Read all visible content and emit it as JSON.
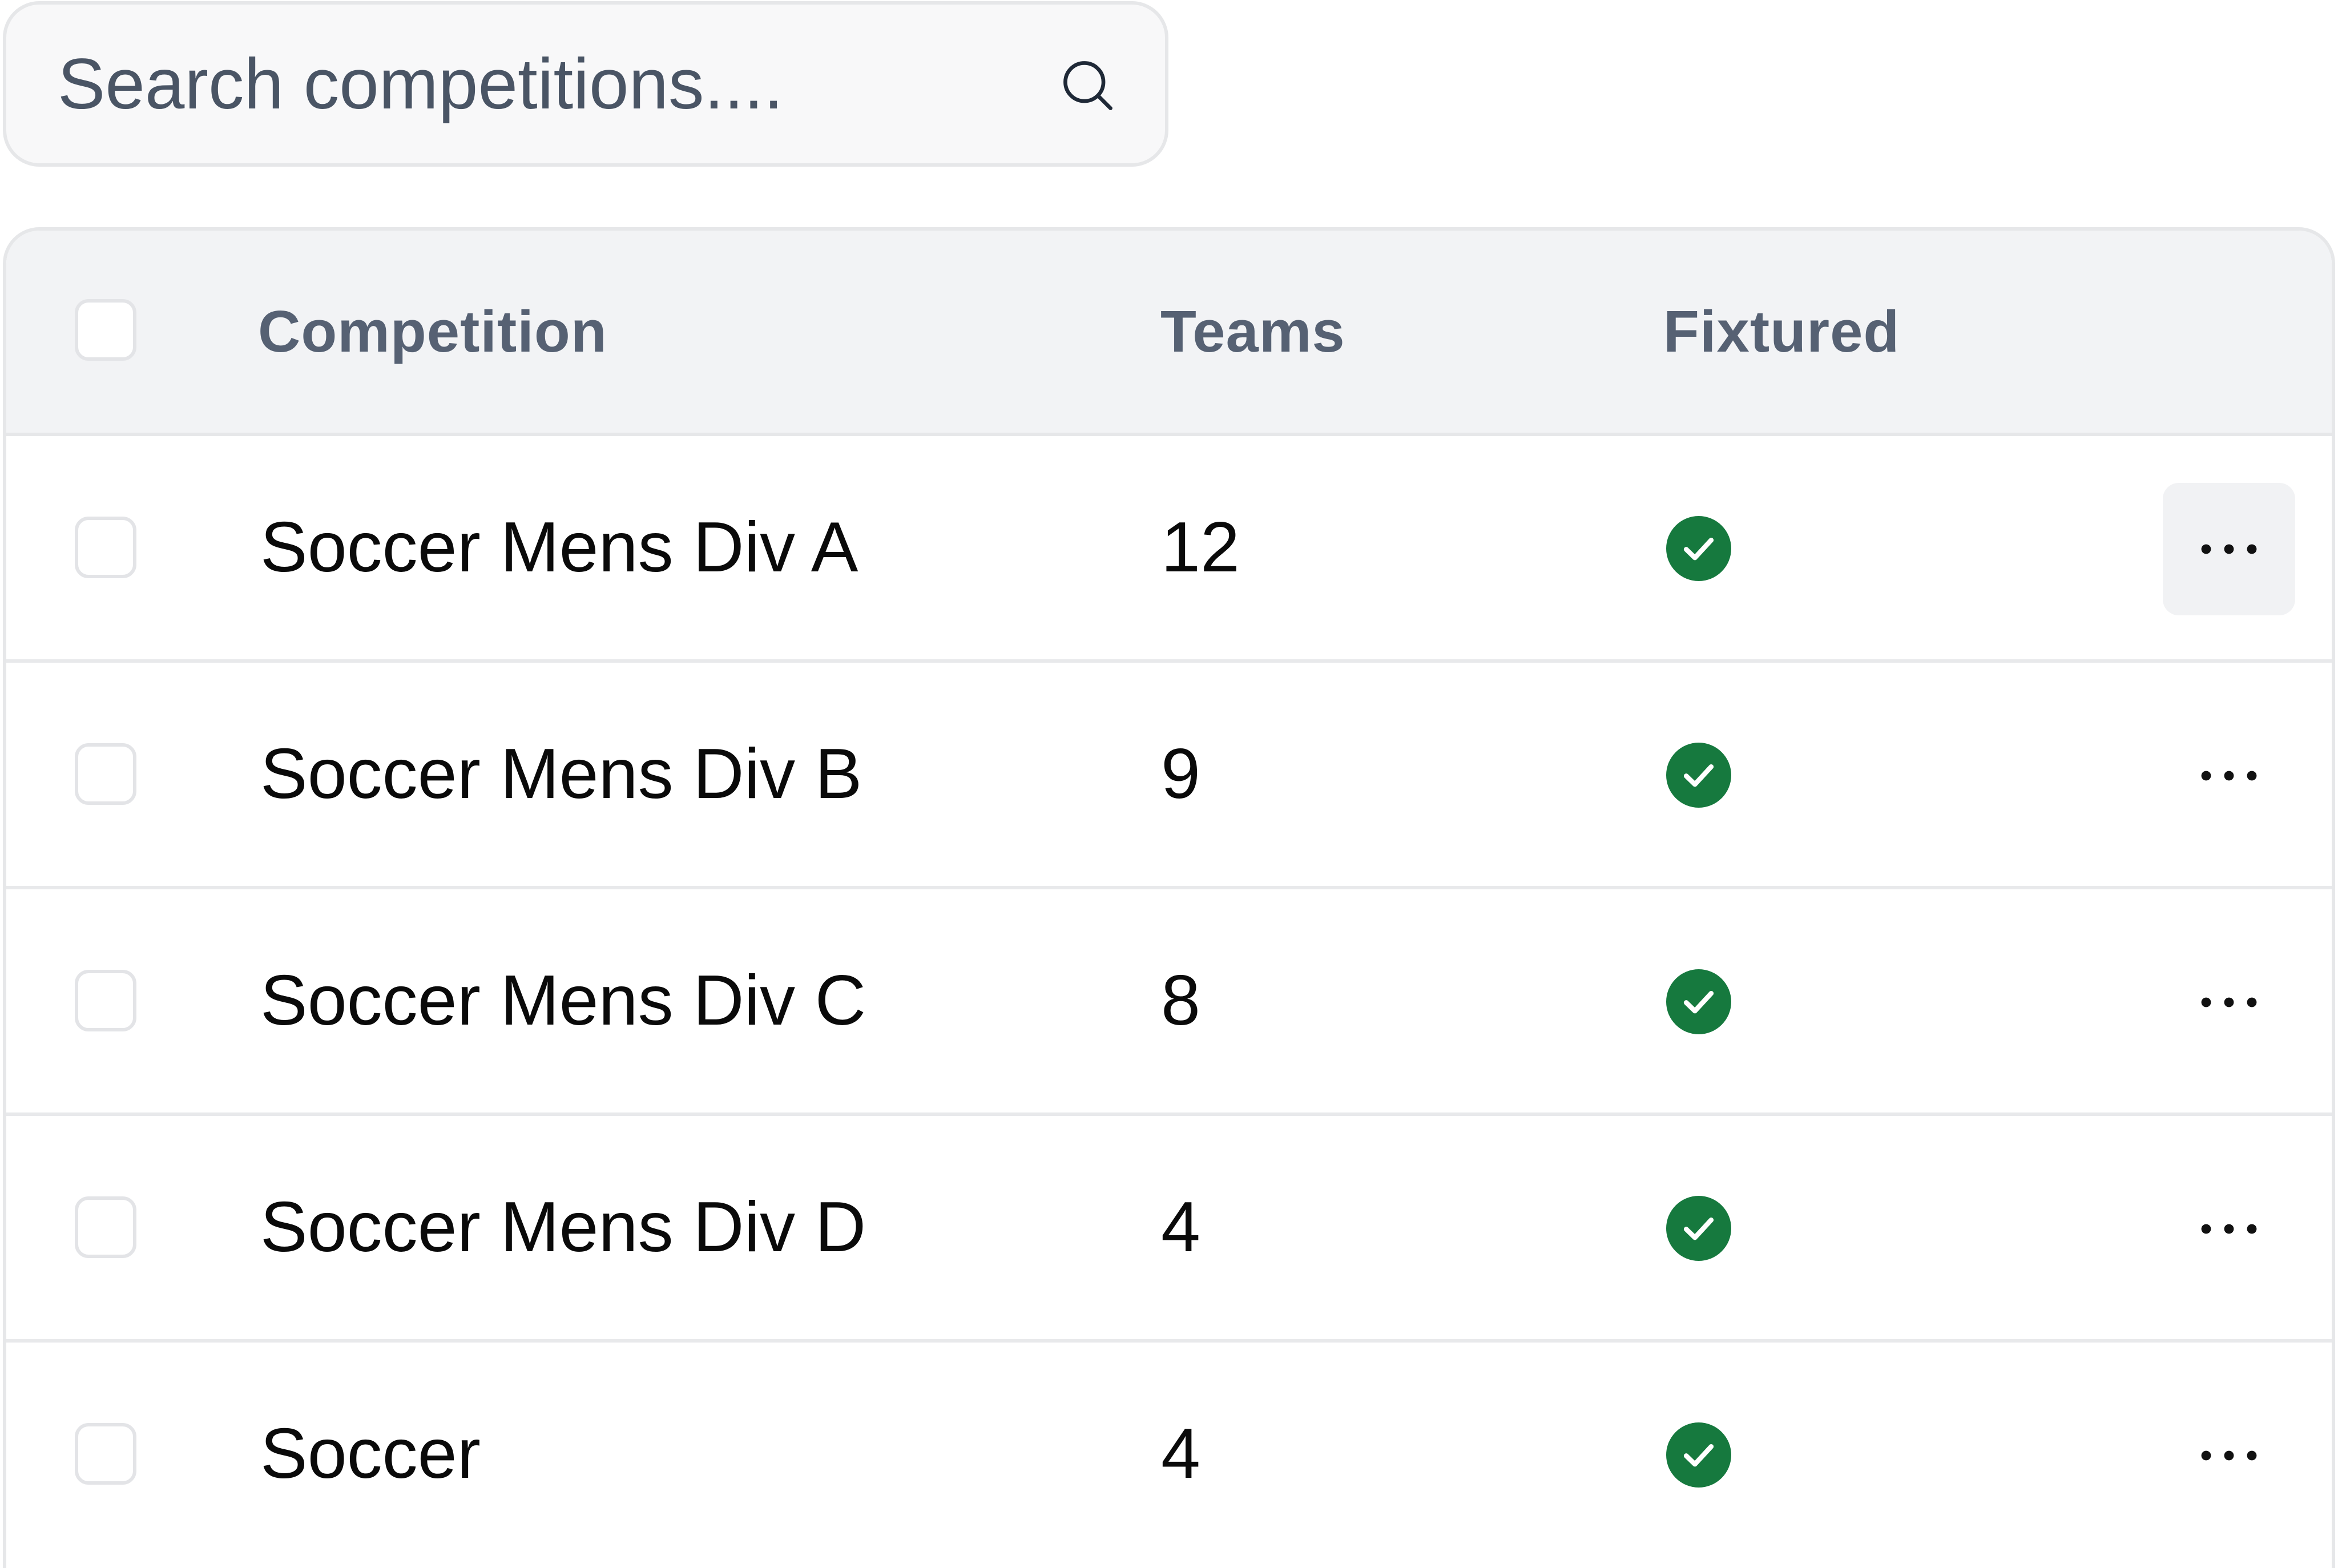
{
  "search": {
    "placeholder": "Search competitions....",
    "icon": "search-icon"
  },
  "table": {
    "headers": {
      "competition": "Competition",
      "teams": "Teams",
      "fixtured": "Fixtured"
    },
    "rows": [
      {
        "name": "Soccer Mens Div A",
        "teams": "12",
        "fixtured": true,
        "selected": false
      },
      {
        "name": "Soccer Mens Div B",
        "teams": "9",
        "fixtured": true,
        "selected": false
      },
      {
        "name": "Soccer Mens Div C",
        "teams": "8",
        "fixtured": true,
        "selected": false
      },
      {
        "name": "Soccer Mens Div D",
        "teams": "4",
        "fixtured": true,
        "selected": false
      },
      {
        "name": "Soccer",
        "teams": "4",
        "fixtured": true,
        "selected": false
      }
    ]
  },
  "colors": {
    "header_text": "#566173",
    "fixtured_check": "#16793e",
    "header_bg": "#f2f3f5",
    "border": "#e6e7e9",
    "more_button_hover_bg": "#f1f2f4"
  },
  "icons": {
    "fixtured": "check-circle-icon",
    "row_actions": "more-horizontal-icon"
  }
}
